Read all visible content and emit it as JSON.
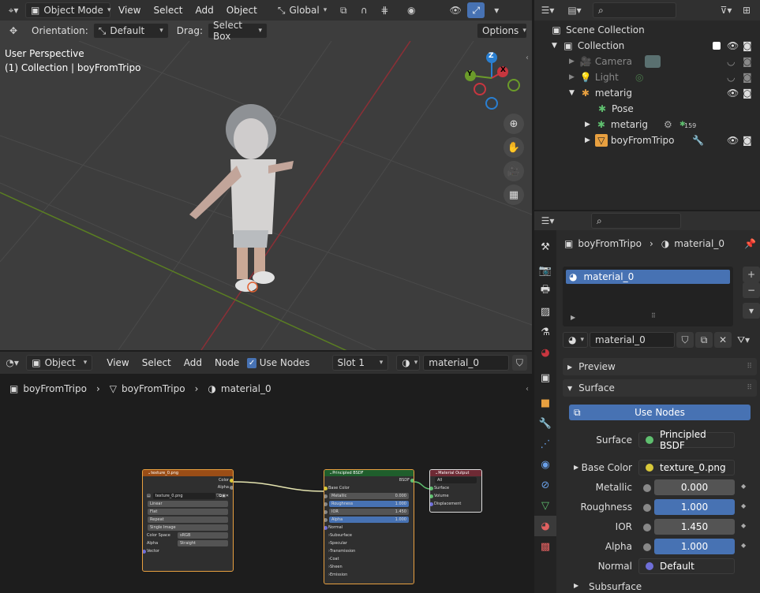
{
  "viewport": {
    "mode": "Object Mode",
    "menus": [
      "View",
      "Select",
      "Add",
      "Object"
    ],
    "transform_orientation": "Global",
    "tool_settings": {
      "orientation_label": "Orientation:",
      "orientation_value": "Default",
      "drag_label": "Drag:",
      "drag_value": "Select Box",
      "options": "Options"
    },
    "overlay_line1": "User Perspective",
    "overlay_line2": "(1) Collection | boyFromTripo",
    "gizmo": {
      "z": "Z",
      "x": "X",
      "y": "Y"
    }
  },
  "outliner": {
    "root": "Scene Collection",
    "items": [
      {
        "label": "Collection"
      },
      {
        "label": "Camera"
      },
      {
        "label": "Light"
      },
      {
        "label": "metarig"
      },
      {
        "label": "Pose"
      },
      {
        "label": "metarig",
        "badge": "159"
      },
      {
        "label": "boyFromTripo"
      }
    ]
  },
  "properties": {
    "breadcrumb_object": "boyFromTripo",
    "breadcrumb_material": "material_0",
    "slot_name": "material_0",
    "material_name": "material_0",
    "panels": {
      "preview": "Preview",
      "surface": "Surface"
    },
    "use_nodes": "Use Nodes",
    "surface_label": "Surface",
    "surface_value": "Principled BSDF",
    "rows": [
      {
        "label": "Base Color",
        "value": "texture_0.png"
      },
      {
        "label": "Metallic",
        "value": "0.000"
      },
      {
        "label": "Roughness",
        "value": "1.000"
      },
      {
        "label": "IOR",
        "value": "1.450"
      },
      {
        "label": "Alpha",
        "value": "1.000"
      },
      {
        "label": "Normal",
        "value": "Default"
      }
    ],
    "subsurface": "Subsurface"
  },
  "node_editor": {
    "object": "Object",
    "menus": [
      "View",
      "Select",
      "Add",
      "Node"
    ],
    "use_nodes": "Use Nodes",
    "slot": "Slot 1",
    "material": "material_0",
    "breadcrumb": [
      "boyFromTripo",
      "boyFromTripo",
      "material_0"
    ],
    "texture_node": {
      "title": "texture_0.png",
      "out_color": "Color",
      "out_alpha": "Alpha",
      "image": "texture_0.png",
      "options": [
        "Linear",
        "Flat",
        "Repeat",
        "Single Image"
      ],
      "color_space_label": "Color Space",
      "color_space": "sRGB",
      "alpha_label": "Alpha",
      "alpha": "Straight",
      "vector": "Vector"
    },
    "bsdf_node": {
      "title": "Principled BSDF",
      "out": "BSDF",
      "base_color": "Base Color",
      "metallic": "Metallic",
      "metallic_v": "0.000",
      "roughness": "Roughness",
      "roughness_v": "1.000",
      "ior": "IOR",
      "ior_v": "1.450",
      "alpha": "Alpha",
      "alpha_v": "1.000",
      "normal": "Normal",
      "subs": [
        "Subsurface",
        "Specular",
        "Transmission",
        "Coat",
        "Sheen",
        "Emission"
      ]
    },
    "output_node": {
      "title": "Material Output",
      "target": "All",
      "inputs": [
        "Surface",
        "Volume",
        "Displacement"
      ]
    }
  },
  "colors": {
    "accent": "#4772b3",
    "x_axis": "#c8363f",
    "y_axis": "#6b9b2a",
    "z_axis": "#2a7fd1",
    "texture_header": "#9a4d16",
    "bsdf_header": "#1f5e2c",
    "output_header": "#6e2a34"
  }
}
